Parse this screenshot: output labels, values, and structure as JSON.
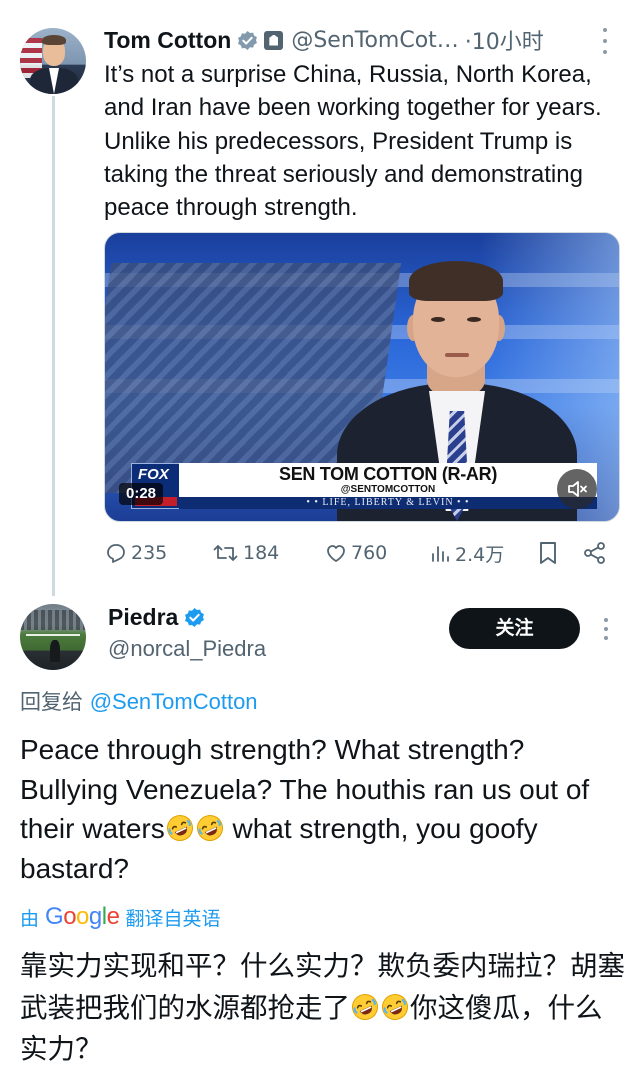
{
  "tweet1": {
    "name": "Tom Cotton",
    "handle": "@SenTomCot…",
    "time": "·10小时",
    "text": "It’s not a surprise China, Russia, North Korea, and Iran have been working together for years. Unlike his predecessors, President Trump is taking the threat seriously and demonstrating peace through strength.",
    "video": {
      "chyron_name": "SEN TOM COTTON (R-AR)",
      "chyron_handle": "@SENTOMCOTTON",
      "show_title": "• • LIFE, LIBERTY & LEVIN • •",
      "network_logo": "FOX",
      "duration": "0:28"
    },
    "stats": {
      "replies": "235",
      "reposts": "184",
      "likes": "760",
      "views": "2.4万"
    }
  },
  "tweet2": {
    "name": "Piedra",
    "handle": "@norcal_Piedra",
    "follow_label": "关注",
    "reply_prefix": "回复给",
    "reply_mention": "@SenTomCotton",
    "text_part1": "Peace through strength? What strength? Bullying Venezuela? The houthis ran us out of their waters",
    "text_part2": " what strength, you goofy bastard?",
    "translated_by_prefix": "由",
    "translated_by_brand": "Google",
    "translated_by_suffix": "翻译自英语",
    "translation_part1": "靠实力实现和平？什么实力？欺负委内瑞拉？胡塞武装把我们的水源都抢走了",
    "translation_part2": "你这傻瓜，什么实力？"
  },
  "icons": {
    "verified": "verified-badge-icon",
    "government": "government-label-icon",
    "reply": "reply-icon",
    "repost": "repost-icon",
    "like": "heart-icon",
    "views": "views-icon",
    "bookmark": "bookmark-icon",
    "share": "share-icon",
    "mute": "mute-icon",
    "emoji": "rolling-on-floor-laughing-emoji"
  },
  "colors": {
    "accent": "#1d9bf0",
    "secondary_text": "#536471",
    "primary_text": "#0f1419",
    "follow_button": "#0f1419"
  }
}
